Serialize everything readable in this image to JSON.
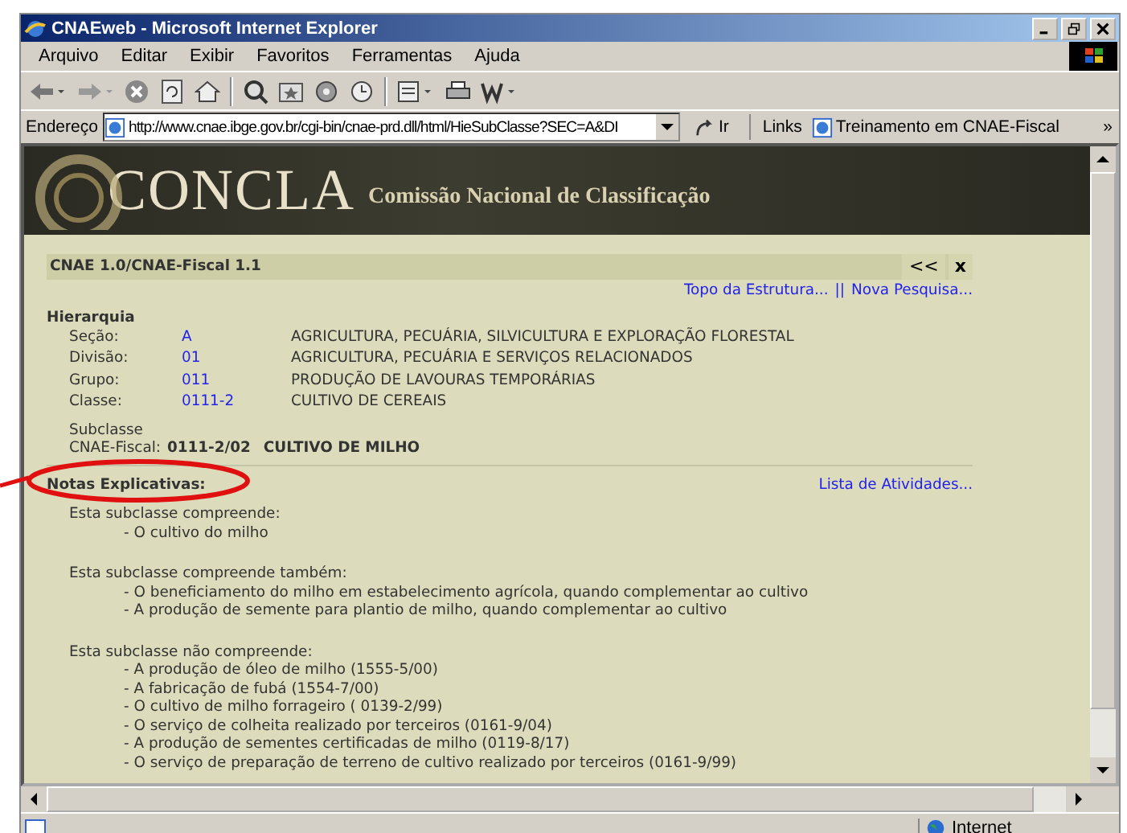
{
  "window": {
    "title": "CNAEweb - Microsoft Internet Explorer"
  },
  "menu": [
    "Arquivo",
    "Editar",
    "Exibir",
    "Favoritos",
    "Ferramentas",
    "Ajuda"
  ],
  "address": {
    "label": "Endereço",
    "value": "http://www.cnae.ibge.gov.br/cgi-bin/cnae-prd.dll/html/HieSubClasse?SEC=A&DI",
    "go": "Ir",
    "links_label": "Links",
    "link": "Treinamento em CNAE-Fiscal",
    "more": "»"
  },
  "banner": {
    "logo": "CONCLA",
    "subtitle": "Comissão Nacional de Classificação"
  },
  "panel": {
    "title": "CNAE 1.0/CNAE-Fiscal 1.1",
    "back": "<<",
    "close": "x",
    "nav_links": [
      "Topo da Estrutura...",
      "||",
      "Nova Pesquisa..."
    ]
  },
  "hierarchy": {
    "heading": "Hierarquia",
    "rows": [
      {
        "label": "Seção:",
        "code": "A",
        "description": "AGRICULTURA, PECUÁRIA, SILVICULTURA E EXPLORAÇÃO FLORESTAL"
      },
      {
        "label": "Divisão:",
        "code": "01",
        "description": "AGRICULTURA, PECUÁRIA E SERVIÇOS RELACIONADOS"
      },
      {
        "label": "Grupo:",
        "code": "011",
        "description": "PRODUÇÃO DE LAVOURAS TEMPORÁRIAS"
      },
      {
        "label": "Classe:",
        "code": "0111-2",
        "description": "CULTIVO DE CEREAIS"
      }
    ],
    "subclass_label": [
      "Subclasse",
      "CNAE-Fiscal:"
    ],
    "subclass_code": "0111-2/02",
    "subclass_name": "CULTIVO DE MILHO"
  },
  "notes": {
    "heading": "Notas Explicativas:",
    "link": "Lista de Atividades...",
    "sections": [
      {
        "title": "Esta subclasse compreende:",
        "items": [
          "- O cultivo do milho"
        ]
      },
      {
        "title": "Esta subclasse compreende também:",
        "items": [
          "- O beneficiamento do milho em estabelecimento agrícola, quando complementar ao cultivo",
          "- A produção de semente para plantio de milho, quando complementar ao cultivo"
        ]
      },
      {
        "title": "Esta subclasse não compreende:",
        "items": [
          "- A produção de óleo de milho (1555-5/00)",
          "- A fabricação de fubá (1554-7/00)",
          "- O cultivo de milho forrageiro ( 0139-2/99)",
          "- O serviço de colheita realizado por terceiros (0161-9/04)",
          "- A produção de sementes certificadas de milho (0119-8/17)",
          "- O serviço de preparação de terreno de cultivo realizado por terceiros (0161-9/99)"
        ]
      }
    ]
  },
  "status_bar": {
    "zone": "Internet"
  }
}
